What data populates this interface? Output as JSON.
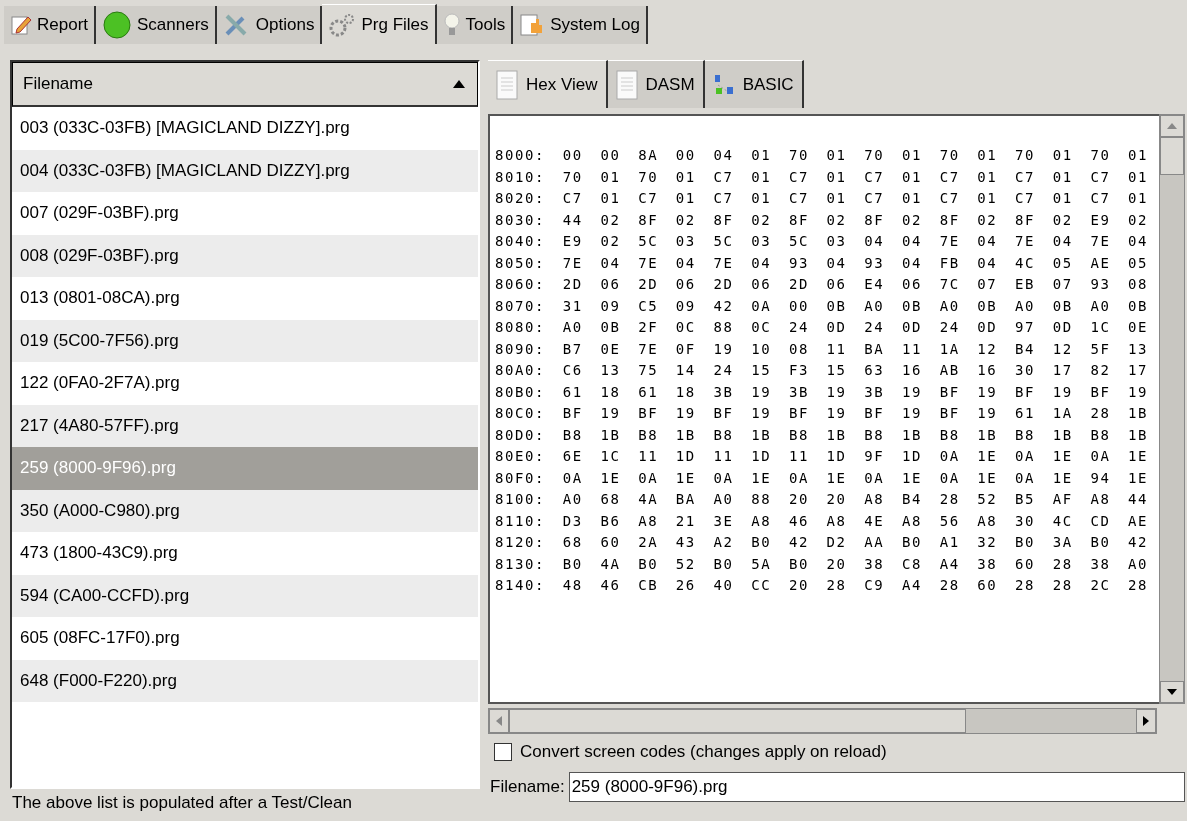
{
  "main_tabs": [
    {
      "label": "Report",
      "selected": false
    },
    {
      "label": "Scanners",
      "selected": false
    },
    {
      "label": "Options",
      "selected": false
    },
    {
      "label": "Prg Files",
      "selected": true
    },
    {
      "label": "Tools",
      "selected": false
    },
    {
      "label": "System Log",
      "selected": false
    }
  ],
  "file_list": {
    "column": "Filename",
    "rows": [
      {
        "name": "003 (033C-03FB) [MAGICLAND DIZZY].prg",
        "selected": false
      },
      {
        "name": "004 (033C-03FB) [MAGICLAND DIZZY].prg",
        "selected": false
      },
      {
        "name": "007 (029F-03BF).prg",
        "selected": false
      },
      {
        "name": "008 (029F-03BF).prg",
        "selected": false
      },
      {
        "name": "013 (0801-08CA).prg",
        "selected": false
      },
      {
        "name": "019 (5C00-7F56).prg",
        "selected": false
      },
      {
        "name": "122 (0FA0-2F7A).prg",
        "selected": false
      },
      {
        "name": "217 (4A80-57FF).prg",
        "selected": false
      },
      {
        "name": "259 (8000-9F96).prg",
        "selected": true
      },
      {
        "name": "350 (A000-C980).prg",
        "selected": false
      },
      {
        "name": "473 (1800-43C9).prg",
        "selected": false
      },
      {
        "name": "594 (CA00-CCFD).prg",
        "selected": false
      },
      {
        "name": "605 (08FC-17F0).prg",
        "selected": false
      },
      {
        "name": "648 (F000-F220).prg",
        "selected": false
      }
    ],
    "footer": "The above list is populated after a Test/Clean"
  },
  "view_tabs": [
    {
      "label": "Hex View",
      "selected": true
    },
    {
      "label": "DASM",
      "selected": false
    },
    {
      "label": "BASIC",
      "selected": false
    }
  ],
  "hex_lines": [
    "8000: 00 00 8A 00 04 01 70 01 70 01 70 01 70 01 70 01",
    "8010: 70 01 70 01 C7 01 C7 01 C7 01 C7 01 C7 01 C7 01",
    "8020: C7 01 C7 01 C7 01 C7 01 C7 01 C7 01 C7 01 C7 01",
    "8030: 44 02 8F 02 8F 02 8F 02 8F 02 8F 02 8F 02 E9 02",
    "8040: E9 02 5C 03 5C 03 5C 03 04 04 7E 04 7E 04 7E 04",
    "8050: 7E 04 7E 04 7E 04 93 04 93 04 FB 04 4C 05 AE 05",
    "8060: 2D 06 2D 06 2D 06 2D 06 E4 06 7C 07 EB 07 93 08",
    "8070: 31 09 C5 09 42 0A 00 0B A0 0B A0 0B A0 0B A0 0B",
    "8080: A0 0B 2F 0C 88 0C 24 0D 24 0D 24 0D 97 0D 1C 0E",
    "8090: B7 0E 7E 0F 19 10 08 11 BA 11 1A 12 B4 12 5F 13",
    "80A0: C6 13 75 14 24 15 F3 15 63 16 AB 16 30 17 82 17",
    "80B0: 61 18 61 18 3B 19 3B 19 3B 19 BF 19 BF 19 BF 19",
    "80C0: BF 19 BF 19 BF 19 BF 19 BF 19 BF 19 61 1A 28 1B",
    "80D0: B8 1B B8 1B B8 1B B8 1B B8 1B B8 1B B8 1B B8 1B",
    "80E0: 6E 1C 11 1D 11 1D 11 1D 9F 1D 0A 1E 0A 1E 0A 1E",
    "80F0: 0A 1E 0A 1E 0A 1E 0A 1E 0A 1E 0A 1E 0A 1E 94 1E",
    "8100: A0 68 4A BA A0 88 20 20 A8 B4 28 52 B5 AF A8 44",
    "8110: D3 B6 A8 21 3E A8 46 A8 4E A8 56 A8 30 4C CD AE",
    "8120: 68 60 2A 43 A2 B0 42 D2 AA B0 A1 32 B0 3A B0 42",
    "8130: B0 4A B0 52 B0 5A B0 20 38 C8 A4 38 60 28 38 A0",
    "8140: 48 46 CB 26 40 CC 20 28 C9 A4 28 60 28 28 2C 28"
  ],
  "convert_screen_codes": {
    "label": "Convert screen codes (changes apply on reload)",
    "checked": false
  },
  "filename_field": {
    "label": "Filename:",
    "value": "259 (8000-9F96).prg"
  }
}
